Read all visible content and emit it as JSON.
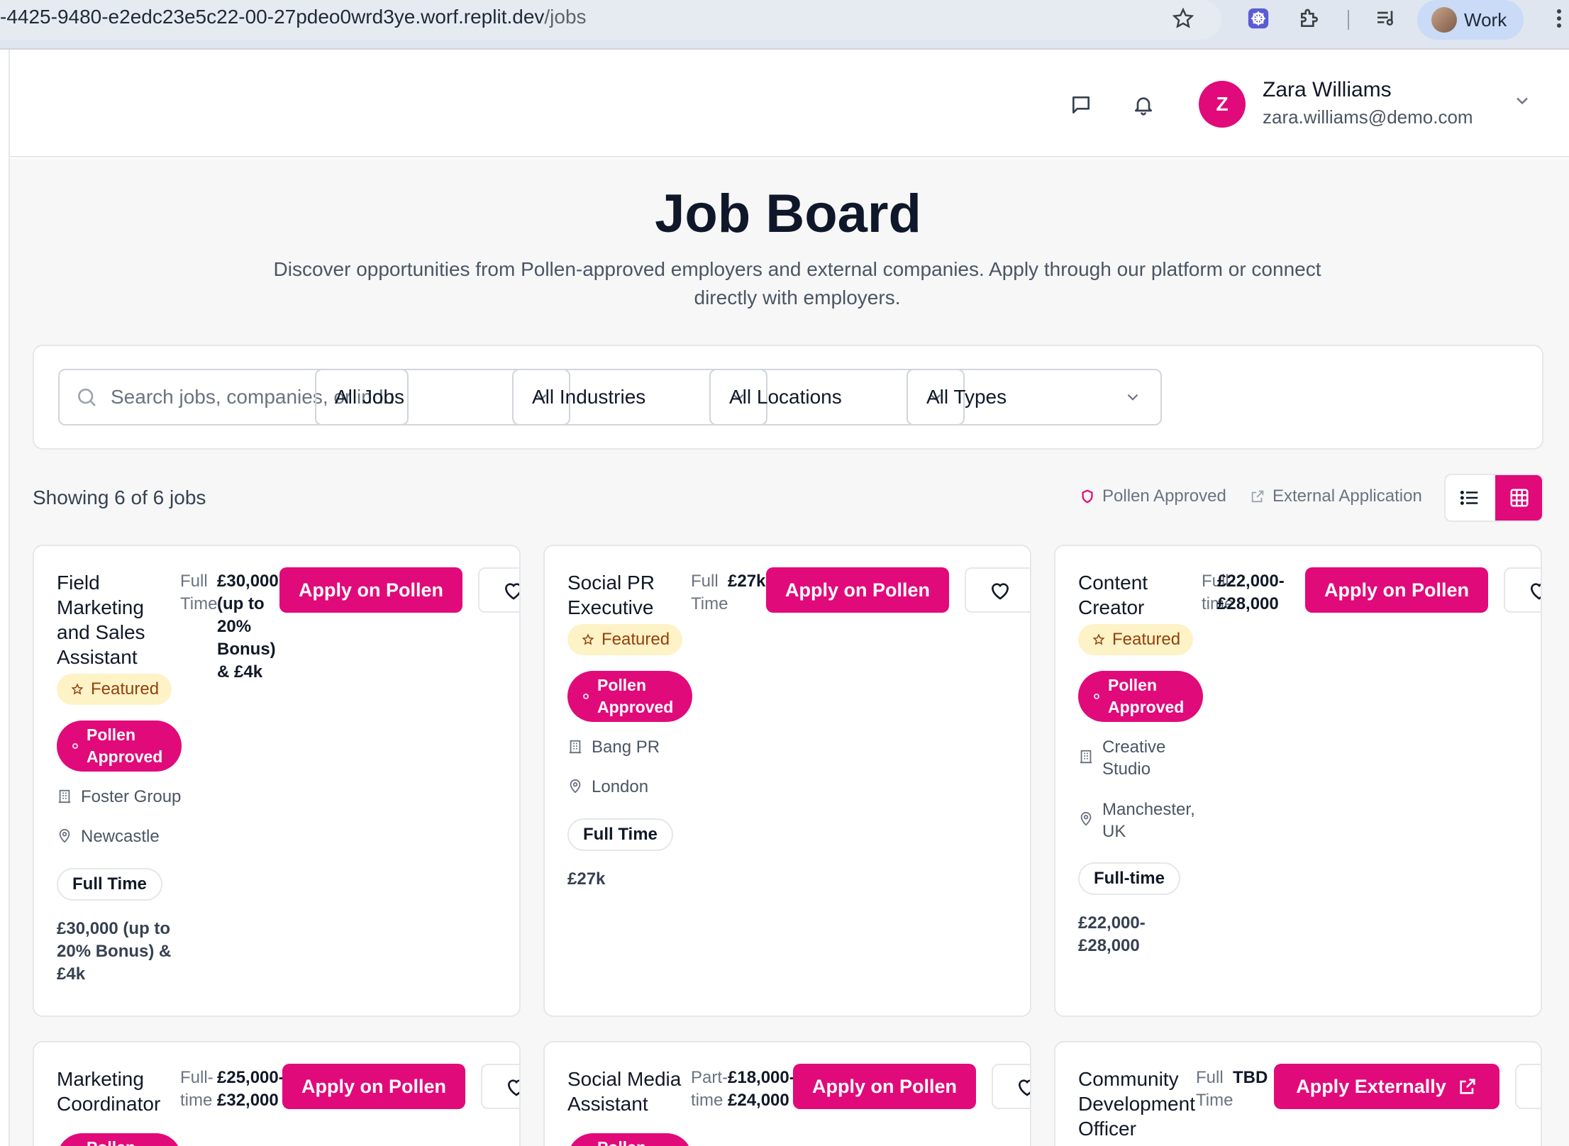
{
  "browser": {
    "url_host": "-4425-9480-e2edc23e5c22-00-27pdeo0wrd3ye.worf.replit.dev",
    "url_path": "/jobs",
    "profile_label": "Work"
  },
  "user": {
    "initial": "Z",
    "name": "Zara Williams",
    "email": "zara.williams@demo.com"
  },
  "page": {
    "title": "Job Board",
    "subtitle": "Discover opportunities from Pollen-approved employers and external companies. Apply through our platform or connect directly with employers."
  },
  "filters": {
    "search_placeholder": "Search jobs, companies, or industries...",
    "jobs": "All Jobs",
    "industries": "All Industries",
    "locations": "All Locations",
    "types": "All Types"
  },
  "results": {
    "showing": "Showing 6 of 6 jobs",
    "legend_pollen": "Pollen Approved",
    "legend_external": "External Application"
  },
  "labels": {
    "featured": "Featured",
    "pollen_approved": "Pollen Approved",
    "apply_pollen": "Apply on Pollen",
    "apply_external": "Apply Externally"
  },
  "jobs": [
    {
      "title": "Field Marketing and Sales Assistant",
      "type_short": "Full Time",
      "salary_short": "£30,000 (up to 20% Bonus) & £4k",
      "company": "Foster Group",
      "location": "Newcastle",
      "type": "Full Time",
      "salary": "£30,000 (up to 20% Bonus) & £4k"
    },
    {
      "title": "Social PR Executive",
      "type_short": "Full Time",
      "salary_short": "£27k",
      "company": "Bang PR",
      "location": "London",
      "type": "Full Time",
      "salary": "£27k"
    },
    {
      "title": "Content Creator",
      "type_short": "Full-time",
      "salary_short": "£22,000-£28,000",
      "company": "Creative Studio",
      "location": "Manchester, UK",
      "type": "Full-time",
      "salary": "£22,000-£28,000"
    },
    {
      "title": "Marketing Coordinator",
      "type_short": "Full-time",
      "salary_short": "£25,000-£32,000"
    },
    {
      "title": "Social Media Assistant",
      "type_short": "Part-time",
      "salary_short": "£18,000-£24,000"
    },
    {
      "title": "Community Development Officer",
      "type_short": "Full Time",
      "salary_short": "TBD"
    }
  ],
  "colors": {
    "brand": "#e10a7a",
    "featured_bg": "#fef3c7",
    "page_bg": "#f7f7f8"
  }
}
